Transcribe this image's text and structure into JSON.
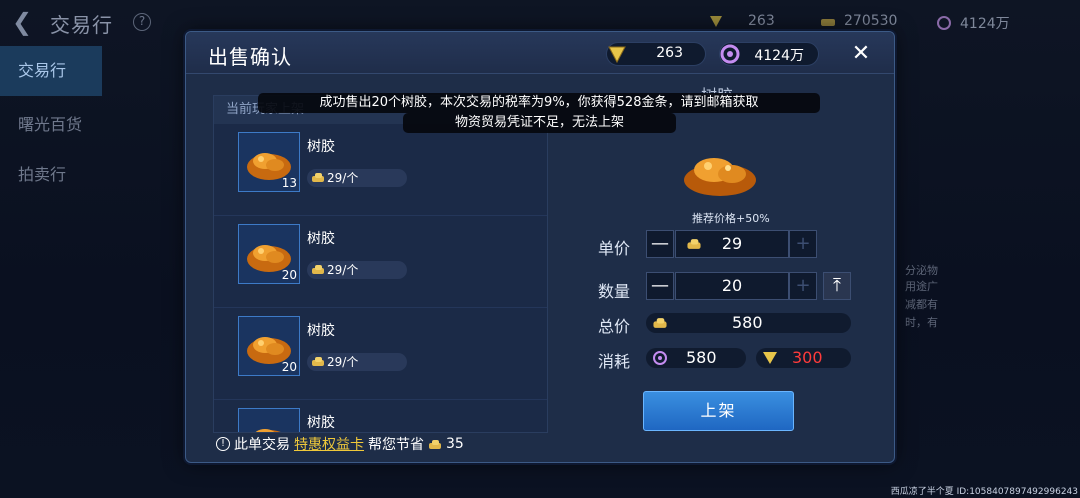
{
  "background": {
    "title": "交易行",
    "help": "?",
    "currencies": [
      {
        "icon": "crystal-icon",
        "value": "263"
      },
      {
        "icon": "gold-bars-icon",
        "value": "270530"
      },
      {
        "icon": "purple-coin-icon",
        "value": "4124万"
      }
    ],
    "sidebar": [
      "交易行",
      "曙光百货",
      "拍卖行"
    ],
    "right_text": [
      "分泌物",
      "用途广",
      "减都有",
      "时，有"
    ]
  },
  "dialog": {
    "title": "出售确认",
    "currency_crystal": "263",
    "currency_purple": "4124万",
    "list_header": "当前玩家上架",
    "items": [
      {
        "name": "树胶",
        "count": "13",
        "price": "29/个"
      },
      {
        "name": "树胶",
        "count": "20",
        "price": "29/个"
      },
      {
        "name": "树胶",
        "count": "20",
        "price": "29/个"
      },
      {
        "name": "树胶",
        "count": "",
        "price": ""
      }
    ],
    "detail_name": "树胶",
    "recommend": "推荐价格+50%",
    "unit_price_label": "单价",
    "unit_price": "29",
    "quantity_label": "数量",
    "quantity": "20",
    "total_label": "总价",
    "total": "580",
    "cost_label": "消耗",
    "cost_purple": "580",
    "cost_crystal": "300",
    "confirm": "上架",
    "footer_prefix": "此单交易",
    "footer_link": "特惠权益卡",
    "footer_suffix": "帮您节省",
    "footer_saving": "35"
  },
  "toasts": [
    "成功售出20个树胶，本次交易的税率为9%，你获得528金条，请到邮箱获取",
    "物资贸易凭证不足，无法上架"
  ],
  "watermark": "西瓜凉了半个夏  ID:1058407897492996243",
  "colors": {
    "accent_blue": "#2f7fd8",
    "cost_red": "#ff3b3b",
    "link_yellow": "#f0c93a"
  }
}
